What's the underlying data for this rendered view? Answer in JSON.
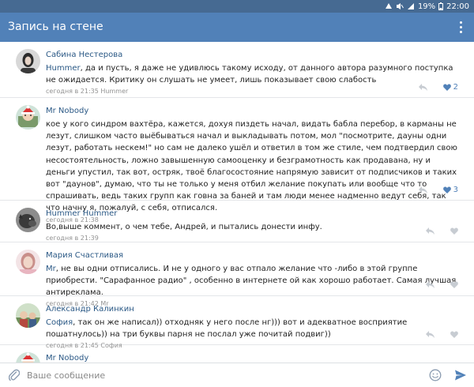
{
  "status_bar": {
    "battery": "19%",
    "time": "22:00"
  },
  "app_bar": {
    "title": "Запись на стене"
  },
  "colors": {
    "header": "#5181b8",
    "statusbar": "#466a92",
    "link": "#2a5885",
    "meta": "#939393",
    "liked": "#5181b8",
    "icon": "#c7ccd2"
  },
  "comments": [
    {
      "author": "Сабина Нестерова",
      "mention": "Hummer",
      "text": ", да и пусть, я даже не удивлюсь такому исходу, от данного автора разумного поступка не ожидается. Критику он слушать не умеет, лишь показывает свою слабость",
      "meta": "сегодня в 21:35 Hummer",
      "likes": "2",
      "liked": true
    },
    {
      "author": "Mr Nobody",
      "mention": "",
      "text": "кое у кого синдром вахтёра, кажется, дохуя пиздеть начал, видать бабла перебор, в карманы не лезут, слишком часто выёбываться начал и выкладывать потом, мол \"посмотрите, дауны одни лезут, работать нескем!\" но сам не далеко ушёл и ответил в том же стиле, чем подтвердил свою несостоятельность, ложно завышенную самооценку и безграмотность как продавана, ну и деньги упустил, так вот, остряк, твоё благосостояние напрямую зависит от подписчиков и таких вот \"даунов\", думаю, что ты не только у меня отбил желание покупать или вообще что то спрашивать, ведь таких групп как говна за баней и там люди менее надменно ведут себя, так что начну я, пожалуй, с себя, отписался.",
      "meta": "сегодня в 21:38",
      "likes": "3",
      "liked": true
    },
    {
      "author": "Hummer Hummer",
      "mention": "",
      "text": "Во,выше коммент, о чем тебе, Андрей, и пытались донести инфу.",
      "meta": "сегодня в 21:39",
      "likes": "",
      "liked": false
    },
    {
      "author": "Мария Счастливая",
      "mention": "Mr",
      "text": ", не вы одни отписались.  И не у одного у вас отпало желание что -либо в этой группе приобрести. \"Сарафанное радио\" , особенно в интернете ой как хорошо работает. Самая лучшая антиреклама.",
      "meta": "сегодня в 21:42 Mr",
      "likes": "",
      "liked": false
    },
    {
      "author": "Александр Калинкин",
      "mention": "София",
      "text": ", так он же написал)) отходняк у него после нг))) вот и адекватное восприятие пошатнулось)) на три буквы парня не послал уже почитай подвиг))",
      "meta": "сегодня в 21:45 София",
      "likes": "",
      "liked": false
    },
    {
      "author": "Mr Nobody",
      "mention": "",
      "text": "",
      "meta": "",
      "likes": "",
      "liked": false
    }
  ],
  "composer": {
    "placeholder": "Ваше сообщение"
  },
  "icons": {
    "menu": "more-vertical-icon",
    "reply": "reply-icon",
    "like": "heart-icon",
    "attach": "paperclip-icon",
    "emoji": "smiley-icon",
    "send": "send-icon"
  }
}
